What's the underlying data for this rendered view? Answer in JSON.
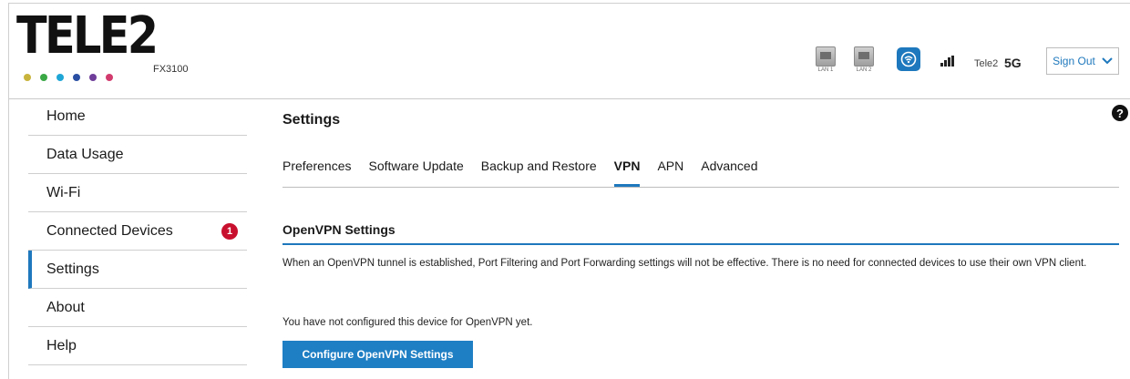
{
  "brand": {
    "name": "TELE2",
    "model": "FX3100",
    "dot_colors": [
      "#c8b43c",
      "#3aa845",
      "#1fa6d6",
      "#2a4fa3",
      "#6f3d9a",
      "#d23b6e"
    ]
  },
  "status": {
    "lan1": "LAN 1",
    "lan2": "LAN 2",
    "wifi_icon": "wifi-icon",
    "signal_icon": "signal-bars-icon",
    "carrier": "Tele2",
    "network": "5G",
    "signout_label": "Sign Out"
  },
  "sidebar": {
    "items": [
      {
        "label": "Home"
      },
      {
        "label": "Data Usage"
      },
      {
        "label": "Wi-Fi"
      },
      {
        "label": "Connected Devices",
        "badge": "1"
      },
      {
        "label": "Settings",
        "active": true
      },
      {
        "label": "About"
      },
      {
        "label": "Help"
      }
    ]
  },
  "main": {
    "title": "Settings",
    "help_glyph": "?",
    "tabs": [
      {
        "label": "Preferences"
      },
      {
        "label": "Software Update"
      },
      {
        "label": "Backup and Restore"
      },
      {
        "label": "VPN",
        "active": true
      },
      {
        "label": "APN"
      },
      {
        "label": "Advanced"
      }
    ],
    "section_title": "OpenVPN Settings",
    "description": "When an OpenVPN tunnel is established, Port Filtering and Port Forwarding settings will not be effective. There is no need for connected devices to use their own VPN client.",
    "notice": "You have not configured this device for OpenVPN yet.",
    "configure_button": "Configure OpenVPN Settings"
  },
  "colors": {
    "accent": "#1e78bd",
    "badge": "#c8102e"
  }
}
